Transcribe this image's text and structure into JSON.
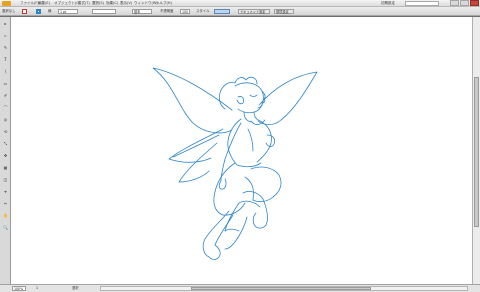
{
  "menubar": {
    "logo_label": "Ai",
    "items": [
      "ファイル(F)",
      "編集(E)",
      "オブジェクト(O)",
      "書式(T)",
      "選択(S)",
      "効果(C)",
      "表示(V)",
      "ウィンドウ(W)",
      "ヘルプ(H)"
    ],
    "workspace": "初期設定",
    "search_placeholder": ""
  },
  "control_bar": {
    "selection_label": "選択なし",
    "stroke_label": "線",
    "stroke_width": "1 pt",
    "brush_label": "基本",
    "opacity_label": "不透明度",
    "opacity_value": "100",
    "style_label": "スタイル",
    "doc_setup_label": "ドキュメント設定",
    "prefs_label": "環境設定"
  },
  "tools": [
    "▸",
    "▹",
    "✎",
    "T",
    "\\",
    "▭",
    "✐",
    "⌒",
    "◎",
    "⟲",
    "⤡",
    "✥",
    "▦",
    "◫",
    "⌖",
    "✂",
    "✋",
    "🔍"
  ],
  "status": {
    "zoom": "100%",
    "page": "1",
    "mode": "選択"
  },
  "colors": {
    "stroke": "#2c86c8",
    "canvas": "#ffffff",
    "chrome": "#d9d9d9"
  }
}
